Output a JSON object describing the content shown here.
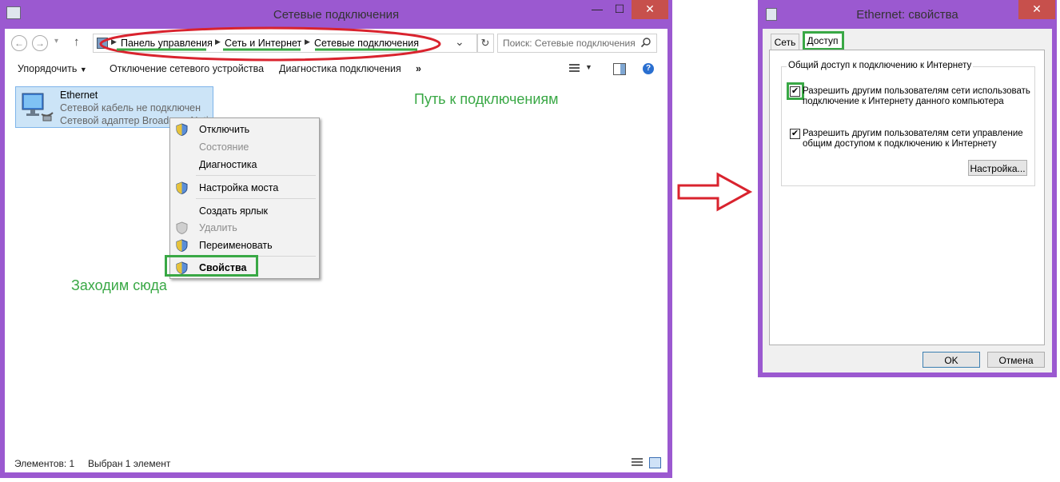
{
  "explorer": {
    "title": "Сетевые подключения",
    "window_buttons": {
      "minimize": "—",
      "maximize": "☐",
      "close": "✕"
    },
    "nav": {
      "back": "←",
      "forward": "→",
      "dropdown": "▾",
      "up": "↑",
      "refresh": "↻",
      "history": "⌄"
    },
    "breadcrumb": [
      "Панель управления",
      "Сеть и Интернет",
      "Сетевые подключения"
    ],
    "search_placeholder": "Поиск: Сетевые подключения",
    "toolbar": {
      "organize": "Упорядочить",
      "disable_device": "Отключение сетевого устройства",
      "diagnose": "Диагностика подключения",
      "more": "»"
    },
    "item": {
      "name": "Ethernet",
      "status": "Сетевой кабель не подключен",
      "adapter": "Сетевой адаптер Broadcom Neti"
    },
    "context_menu": [
      {
        "label": "Отключить",
        "enabled": true,
        "shield": true
      },
      {
        "label": "Состояние",
        "enabled": false,
        "shield": false
      },
      {
        "label": "Диагностика",
        "enabled": true,
        "shield": false
      },
      {
        "label": "Настройка моста",
        "enabled": true,
        "shield": true
      },
      {
        "label": "Создать ярлык",
        "enabled": true,
        "shield": false
      },
      {
        "label": "Удалить",
        "enabled": false,
        "shield": true
      },
      {
        "label": "Переименовать",
        "enabled": true,
        "shield": true
      },
      {
        "label": "Свойства",
        "enabled": true,
        "shield": true
      }
    ],
    "annotations": {
      "path": "Путь к подключениям",
      "go_here": "Заходим сюда"
    },
    "status_bar": {
      "count": "Элементов: 1",
      "selected": "Выбран 1 элемент"
    }
  },
  "dialog": {
    "title": "Ethernet: свойства",
    "close": "✕",
    "tabs": [
      "Сеть",
      "Доступ"
    ],
    "group_label": "Общий доступ к подключению к Интернету",
    "checkbox1": "Разрешить другим пользователям сети использовать подключение к Интернету данного компьютера",
    "checkbox2": "Разрешить другим пользователям сети управление общим доступом к подключению к Интернету",
    "settings_button": "Настройка...",
    "ok": "OK",
    "cancel": "Отмена"
  },
  "colors": {
    "frame": "#9b59d0",
    "annotation_red": "#d9232e",
    "annotation_green": "#39a845",
    "selection": "#cce4f7",
    "close_button": "#c7504c"
  }
}
